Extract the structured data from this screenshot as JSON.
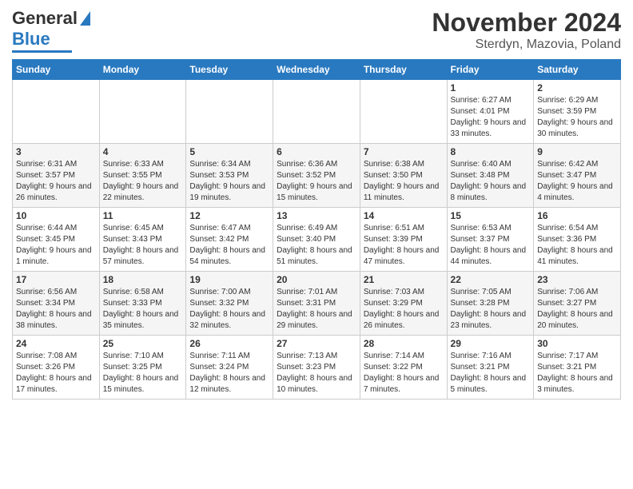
{
  "logo": {
    "line1": "General",
    "line2": "Blue"
  },
  "header": {
    "month": "November 2024",
    "location": "Sterdyn, Mazovia, Poland"
  },
  "days_of_week": [
    "Sunday",
    "Monday",
    "Tuesday",
    "Wednesday",
    "Thursday",
    "Friday",
    "Saturday"
  ],
  "weeks": [
    [
      {
        "day": "",
        "info": ""
      },
      {
        "day": "",
        "info": ""
      },
      {
        "day": "",
        "info": ""
      },
      {
        "day": "",
        "info": ""
      },
      {
        "day": "",
        "info": ""
      },
      {
        "day": "1",
        "info": "Sunrise: 6:27 AM\nSunset: 4:01 PM\nDaylight: 9 hours and 33 minutes."
      },
      {
        "day": "2",
        "info": "Sunrise: 6:29 AM\nSunset: 3:59 PM\nDaylight: 9 hours and 30 minutes."
      }
    ],
    [
      {
        "day": "3",
        "info": "Sunrise: 6:31 AM\nSunset: 3:57 PM\nDaylight: 9 hours and 26 minutes."
      },
      {
        "day": "4",
        "info": "Sunrise: 6:33 AM\nSunset: 3:55 PM\nDaylight: 9 hours and 22 minutes."
      },
      {
        "day": "5",
        "info": "Sunrise: 6:34 AM\nSunset: 3:53 PM\nDaylight: 9 hours and 19 minutes."
      },
      {
        "day": "6",
        "info": "Sunrise: 6:36 AM\nSunset: 3:52 PM\nDaylight: 9 hours and 15 minutes."
      },
      {
        "day": "7",
        "info": "Sunrise: 6:38 AM\nSunset: 3:50 PM\nDaylight: 9 hours and 11 minutes."
      },
      {
        "day": "8",
        "info": "Sunrise: 6:40 AM\nSunset: 3:48 PM\nDaylight: 9 hours and 8 minutes."
      },
      {
        "day": "9",
        "info": "Sunrise: 6:42 AM\nSunset: 3:47 PM\nDaylight: 9 hours and 4 minutes."
      }
    ],
    [
      {
        "day": "10",
        "info": "Sunrise: 6:44 AM\nSunset: 3:45 PM\nDaylight: 9 hours and 1 minute."
      },
      {
        "day": "11",
        "info": "Sunrise: 6:45 AM\nSunset: 3:43 PM\nDaylight: 8 hours and 57 minutes."
      },
      {
        "day": "12",
        "info": "Sunrise: 6:47 AM\nSunset: 3:42 PM\nDaylight: 8 hours and 54 minutes."
      },
      {
        "day": "13",
        "info": "Sunrise: 6:49 AM\nSunset: 3:40 PM\nDaylight: 8 hours and 51 minutes."
      },
      {
        "day": "14",
        "info": "Sunrise: 6:51 AM\nSunset: 3:39 PM\nDaylight: 8 hours and 47 minutes."
      },
      {
        "day": "15",
        "info": "Sunrise: 6:53 AM\nSunset: 3:37 PM\nDaylight: 8 hours and 44 minutes."
      },
      {
        "day": "16",
        "info": "Sunrise: 6:54 AM\nSunset: 3:36 PM\nDaylight: 8 hours and 41 minutes."
      }
    ],
    [
      {
        "day": "17",
        "info": "Sunrise: 6:56 AM\nSunset: 3:34 PM\nDaylight: 8 hours and 38 minutes."
      },
      {
        "day": "18",
        "info": "Sunrise: 6:58 AM\nSunset: 3:33 PM\nDaylight: 8 hours and 35 minutes."
      },
      {
        "day": "19",
        "info": "Sunrise: 7:00 AM\nSunset: 3:32 PM\nDaylight: 8 hours and 32 minutes."
      },
      {
        "day": "20",
        "info": "Sunrise: 7:01 AM\nSunset: 3:31 PM\nDaylight: 8 hours and 29 minutes."
      },
      {
        "day": "21",
        "info": "Sunrise: 7:03 AM\nSunset: 3:29 PM\nDaylight: 8 hours and 26 minutes."
      },
      {
        "day": "22",
        "info": "Sunrise: 7:05 AM\nSunset: 3:28 PM\nDaylight: 8 hours and 23 minutes."
      },
      {
        "day": "23",
        "info": "Sunrise: 7:06 AM\nSunset: 3:27 PM\nDaylight: 8 hours and 20 minutes."
      }
    ],
    [
      {
        "day": "24",
        "info": "Sunrise: 7:08 AM\nSunset: 3:26 PM\nDaylight: 8 hours and 17 minutes."
      },
      {
        "day": "25",
        "info": "Sunrise: 7:10 AM\nSunset: 3:25 PM\nDaylight: 8 hours and 15 minutes."
      },
      {
        "day": "26",
        "info": "Sunrise: 7:11 AM\nSunset: 3:24 PM\nDaylight: 8 hours and 12 minutes."
      },
      {
        "day": "27",
        "info": "Sunrise: 7:13 AM\nSunset: 3:23 PM\nDaylight: 8 hours and 10 minutes."
      },
      {
        "day": "28",
        "info": "Sunrise: 7:14 AM\nSunset: 3:22 PM\nDaylight: 8 hours and 7 minutes."
      },
      {
        "day": "29",
        "info": "Sunrise: 7:16 AM\nSunset: 3:21 PM\nDaylight: 8 hours and 5 minutes."
      },
      {
        "day": "30",
        "info": "Sunrise: 7:17 AM\nSunset: 3:21 PM\nDaylight: 8 hours and 3 minutes."
      }
    ]
  ]
}
